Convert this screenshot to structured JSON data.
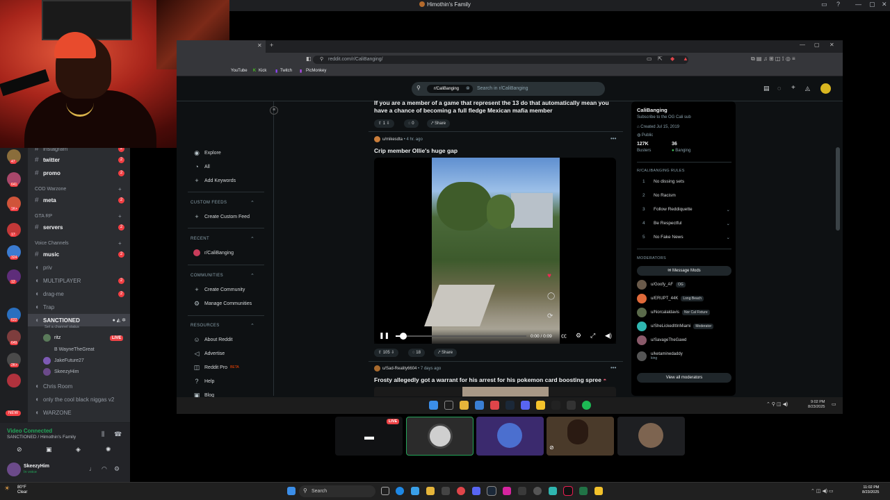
{
  "discord": {
    "window_title": "Himothin's Family",
    "channels": [
      {
        "label": "instagram",
        "badge": "2"
      },
      {
        "label": "twitter",
        "badge": "2"
      },
      {
        "label": "promo",
        "badge": "2"
      },
      {
        "label": "meta",
        "badge": "2"
      },
      {
        "label": "servers",
        "badge": "2"
      },
      {
        "label": "music",
        "badge": "2"
      },
      {
        "label": "priv",
        "badge": ""
      },
      {
        "label": "MULTIPLAYER",
        "badge": "2"
      },
      {
        "label": "drag-me",
        "badge": "2"
      },
      {
        "label": "Trap",
        "badge": ""
      },
      {
        "label": "SANCTIONED",
        "badge": ""
      },
      {
        "label": "Chris Room",
        "badge": ""
      },
      {
        "label": "only the cool black niggas v2",
        "badge": ""
      },
      {
        "label": "WARZONE",
        "badge": ""
      }
    ],
    "categories": {
      "cod": "COD Warzone",
      "gta": "GTA RP",
      "voice": "Voice Channels"
    },
    "channel_status": "Set a channel status",
    "voice_users": [
      {
        "name": "ritz",
        "live": "LIVE"
      },
      {
        "name": "B WayneTheGreat",
        "live": ""
      },
      {
        "name": "JakeFuture27",
        "live": ""
      },
      {
        "name": "SkeezyHim",
        "live": ""
      }
    ],
    "server_badges": [
      "47",
      "641",
      "1K+",
      "17",
      "324",
      "12",
      "622",
      "649",
      "2K+",
      "NEW"
    ],
    "voice_panel": {
      "status": "Video Connected",
      "location": "SANCTIONED / Himothin's Family"
    },
    "user": {
      "name": "SkeezyHim",
      "status": "In voice"
    }
  },
  "browser": {
    "url": "reddit.com/r/CaliBanging/",
    "bookmarks": [
      "YouTube",
      "Kick",
      "Twitch",
      "PicMonkey"
    ]
  },
  "reddit": {
    "search_chip": "r/CaliBanging",
    "search_placeholder": "Search in r/CaliBanging",
    "nav": {
      "explore": "Explore",
      "all": "All",
      "add_keywords": "Add Keywords",
      "custom_feeds": "CUSTOM FEEDS",
      "create_custom_feed": "Create Custom Feed",
      "recent": "RECENT",
      "recent_item": "r/CaliBanging",
      "communities": "COMMUNITIES",
      "create_community": "Create Community",
      "manage_communities": "Manage Communities",
      "resources": "RESOURCES",
      "about": "About Reddit",
      "advertise": "Advertise",
      "reddit_pro": "Reddit Pro",
      "beta": "BETA",
      "help": "Help",
      "blog": "Blog"
    },
    "posts": [
      {
        "title_line1": "If you are a member of a game that represent the 13 do that automatically mean you",
        "title_line2": "have a chance of becoming a full fledge Mexican mafia member",
        "votes": "1",
        "comments": "0",
        "share": "Share"
      },
      {
        "author": "u/mikesdta",
        "age": "• 4 hr. ago",
        "title": "Crip member Ollie's huge gap",
        "votes": "105",
        "comments": "18",
        "share": "Share",
        "time": "0:00 / 0:09",
        "video_progress": 0.06
      },
      {
        "author": "u/Sad-Reality6604",
        "age": "• 7 days ago",
        "title": "Frosty allegedly got a warrant for his arrest for his pokemon card boosting spree"
      }
    ],
    "sidebar": {
      "name": "CaliBanging",
      "description": "Subscribe to the OG Cali sub",
      "created": "Created Jul 15, 2019",
      "visibility": "Public",
      "members": "127K",
      "members_label": "Busters",
      "online": "36",
      "online_label": "Banging",
      "rules_header": "R/CALIBANGING RULES",
      "rules": [
        {
          "n": "1",
          "text": "No dissing sets"
        },
        {
          "n": "2",
          "text": "No Racism"
        },
        {
          "n": "3",
          "text": "Follow Reddiquette"
        },
        {
          "n": "4",
          "text": "Be Respectful"
        },
        {
          "n": "5",
          "text": "No Fake News"
        }
      ],
      "moderators_header": "MODERATORS",
      "message_mods": "Message Mods",
      "moderators": [
        {
          "name": "u/Goofy_AF",
          "flair": "OG"
        },
        {
          "name": "u/ERUPT_44K",
          "flair": "Long Beach"
        },
        {
          "name": "u/Norcalaldavis",
          "flair": "Nor Cal Fixture"
        },
        {
          "name": "u/SheLickedItInMiami",
          "flair": "Moderator"
        },
        {
          "name": "u/SavageTheGawd",
          "flair": ""
        },
        {
          "name": "u/ketaminedaddy",
          "flair": "king"
        }
      ],
      "view_all": "View all moderators"
    }
  },
  "inner_taskbar": {
    "time": "9:02 PM",
    "date": "8/23/2025"
  },
  "stream_tiles": {
    "live_badge": "LIVE"
  },
  "windows_taskbar": {
    "weather_temp": "80°F",
    "weather_desc": "Clear",
    "search": "Search",
    "time": "11:02 PM",
    "date": "8/23/2025"
  }
}
